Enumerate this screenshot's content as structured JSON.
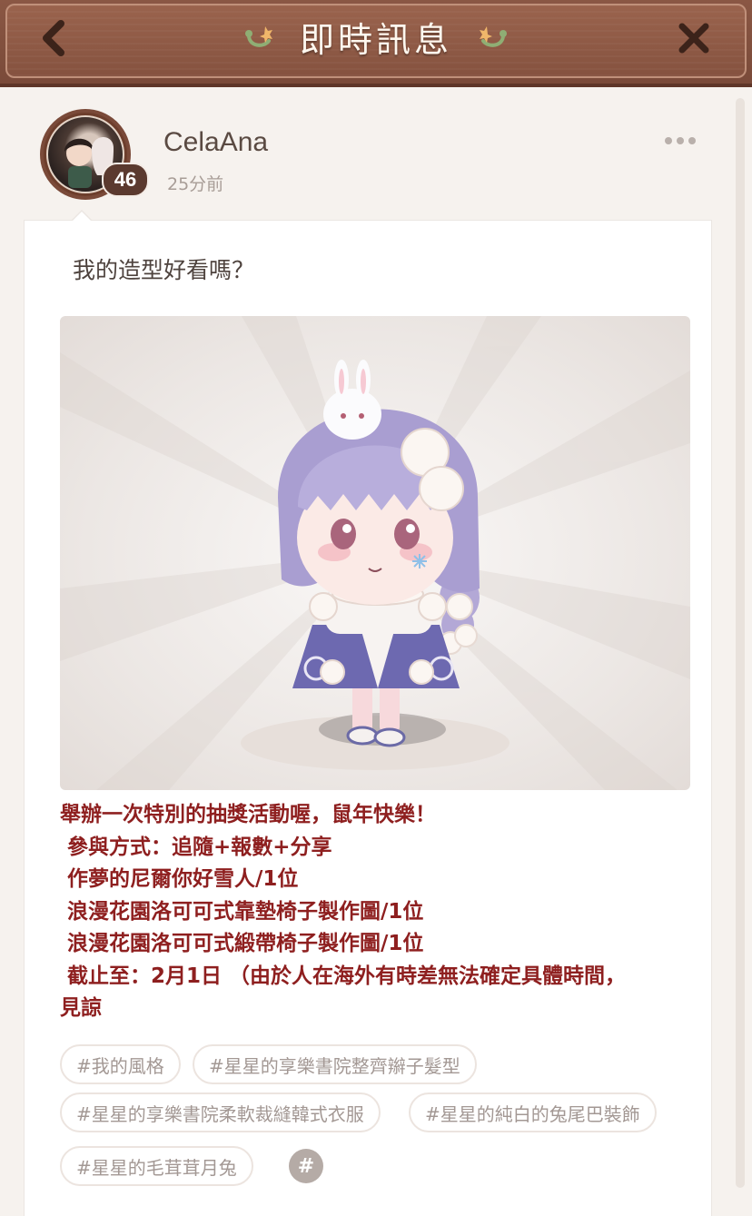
{
  "header": {
    "title": "即時訊息",
    "back_icon": "chevron-left-icon",
    "close_icon": "close-icon"
  },
  "post": {
    "username": "CelaAna",
    "level": "46",
    "time_ago": "25分前",
    "caption": "我的造型好看嗎？",
    "description_lines": [
      "舉辦一次特別的抽獎活動喔，鼠年快樂！",
      " 參與方式：追隨+報數+分享",
      " 作夢的尼爾你好雪人/1位",
      " 浪漫花園洛可可式靠墊椅子製作圖/1位",
      " 浪漫花園洛可可式緞帶椅子製作圖/1位",
      " 截止至：2月1日 （由於人在海外有時差無法確定具體時間，",
      "見諒"
    ],
    "tags": [
      "#我的風格",
      "#星星的享樂書院整齊辮子髮型",
      "#星星的享樂書院柔軟裁縫韓式衣服",
      "#星星的純白的兔尾巴裝飾",
      "#星星的毛茸茸月兔"
    ],
    "add_tag_label": "#"
  },
  "colors": {
    "header_bg": "#85523f",
    "description_text": "#8e1f1f",
    "tag_text": "#a39894"
  }
}
